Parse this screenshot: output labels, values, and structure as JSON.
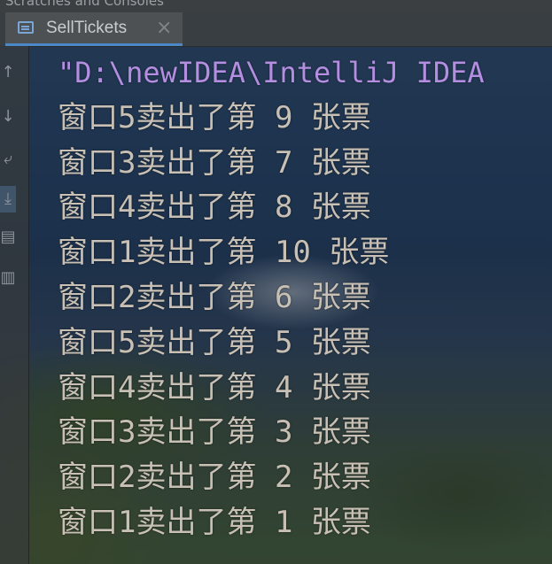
{
  "top_strip_text": "Scratches and Consoles",
  "tab": {
    "title": "SellTickets",
    "icon": "console-icon",
    "close_glyph": "×"
  },
  "gutter_icons": [
    "arrow-up-icon",
    "arrow-down-icon",
    "soft-wrap-icon",
    "scroll-to-end-icon",
    "print-icon",
    "trash-icon"
  ],
  "console": {
    "command": "\"D:\\newIDEA\\IntelliJ IDEA",
    "lines": [
      "窗口5卖出了第 9 张票",
      "窗口3卖出了第 7 张票",
      "窗口4卖出了第 8 张票",
      "窗口1卖出了第 10 张票",
      "窗口2卖出了第 6 张票",
      "窗口5卖出了第 5 张票",
      "窗口4卖出了第 4 张票",
      "窗口3卖出了第 3 张票",
      "窗口2卖出了第 2 张票",
      "窗口1卖出了第 1 张票"
    ]
  },
  "colors": {
    "command_text": "#b48ee0",
    "output_text": "#c8c0b4",
    "tab_accent": "#4a88c7"
  }
}
